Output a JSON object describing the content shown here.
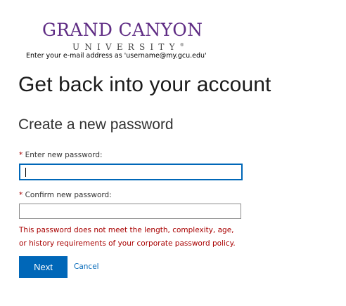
{
  "logo": {
    "title": "GRAND CANYON",
    "subtitle": "UNIVERSITY",
    "trademark": "®",
    "color": "#5f2c84"
  },
  "banner_note": "Enter your e-mail address as 'username@my.gcu.edu'",
  "page_title": "Get back into your account",
  "section_title": "Create a new password",
  "fields": {
    "new_password": {
      "required_marker": "*",
      "label": "Enter new password:",
      "value": ""
    },
    "confirm_password": {
      "required_marker": "*",
      "label": "Confirm new password:",
      "value": ""
    }
  },
  "error": {
    "line1": "This password does not meet the length, complexity, age,",
    "line2": "or history requirements of your corporate password policy."
  },
  "actions": {
    "next_label": "Next",
    "cancel_label": "Cancel"
  },
  "colors": {
    "accent": "#0067b8",
    "error": "#a80000"
  }
}
